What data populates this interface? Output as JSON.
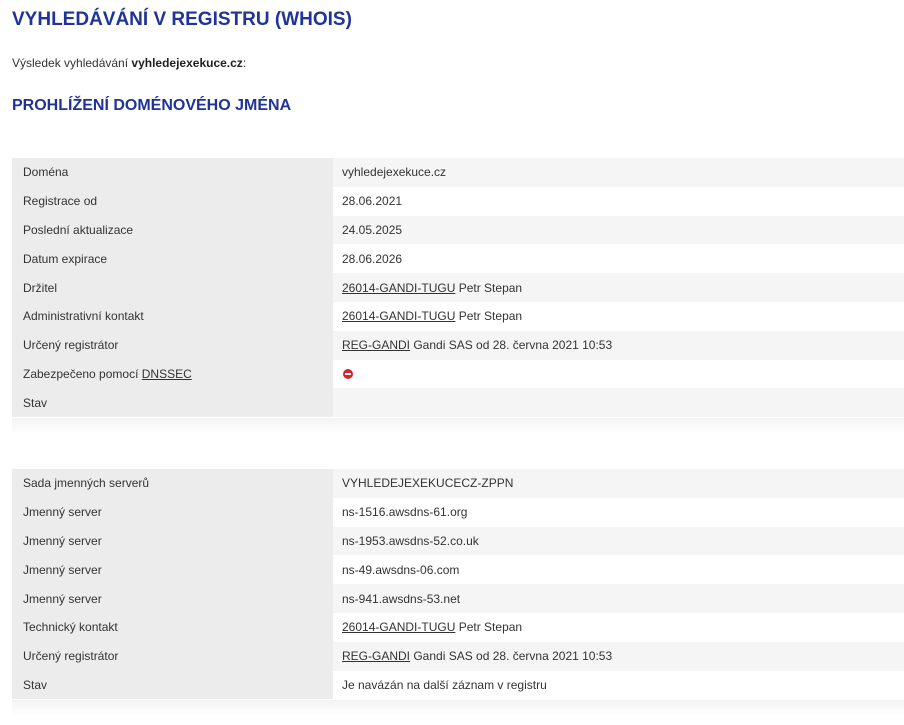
{
  "page": {
    "title": "VYHLEDÁVÁNÍ V REGISTRU (WHOIS)",
    "result_prefix": "Výsledek vyhledávání ",
    "result_domain": "vyhledejexekuce.cz",
    "result_suffix": ":",
    "section_title": "PROHLÍŽENÍ DOMÉNOVÉHO JMÉNA"
  },
  "domain_table": {
    "domain_label": "Doména",
    "domain_value": "vyhledejexekuce.cz",
    "registered_label": "Registrace od",
    "registered_value": "28.06.2021",
    "updated_label": "Poslední aktualizace",
    "updated_value": "24.05.2025",
    "expiry_label": "Datum expirace",
    "expiry_value": "28.06.2026",
    "holder_label": "Držitel",
    "holder_link": "26014-GANDI-TUGU",
    "holder_name": " Petr Stepan",
    "admin_label": "Administrativní kontakt",
    "admin_link": "26014-GANDI-TUGU",
    "admin_name": " Petr Stepan",
    "registrar_label": "Určený registrátor",
    "registrar_link": "REG-GANDI",
    "registrar_text": " Gandi SAS od 28. června 2021 10:53",
    "dnssec_label_prefix": "Zabezpečeno pomocí ",
    "dnssec_link": "DNSSEC",
    "dnssec_status_icon": "minus-circle-icon",
    "state_label": "Stav",
    "state_value": ""
  },
  "nsset_table": {
    "nsset_label": "Sada jmenných serverů",
    "nsset_value": "VYHLEDEJEXEKUCECZ-ZPPN",
    "nameservers": [
      {
        "label": "Jmenný server",
        "value": "ns-1516.awsdns-61.org"
      },
      {
        "label": "Jmenný server",
        "value": "ns-1953.awsdns-52.co.uk"
      },
      {
        "label": "Jmenný server",
        "value": "ns-49.awsdns-06.com"
      },
      {
        "label": "Jmenný server",
        "value": "ns-941.awsdns-53.net"
      }
    ],
    "tech_label": "Technický kontakt",
    "tech_link": "26014-GANDI-TUGU",
    "tech_name": " Petr Stepan",
    "registrar_label": "Určený registrátor",
    "registrar_link": "REG-GANDI",
    "registrar_text": " Gandi SAS od 28. června 2021 10:53",
    "state_label": "Stav",
    "state_value": "Je navázán na další záznam v registru"
  },
  "colors": {
    "heading": "#1f3399",
    "deny_icon": "#d6252b"
  }
}
